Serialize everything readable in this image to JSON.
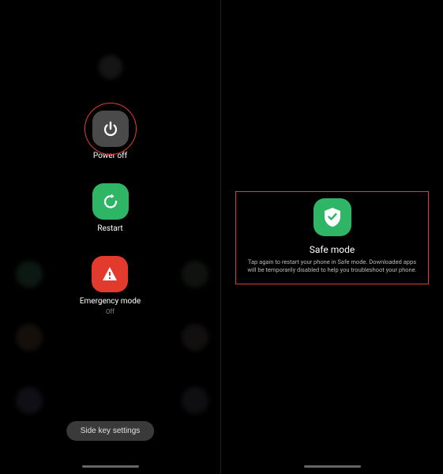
{
  "left": {
    "power_off": {
      "label": "Power off"
    },
    "restart": {
      "label": "Restart"
    },
    "emergency": {
      "label": "Emergency mode",
      "sublabel": "Off"
    },
    "side_key_button": "Side key settings"
  },
  "right": {
    "safe_mode": {
      "title": "Safe mode",
      "description": "Tap again to restart your phone in Safe mode. Downloaded apps will be temporarily disabled to help you troubleshoot your phone."
    }
  }
}
